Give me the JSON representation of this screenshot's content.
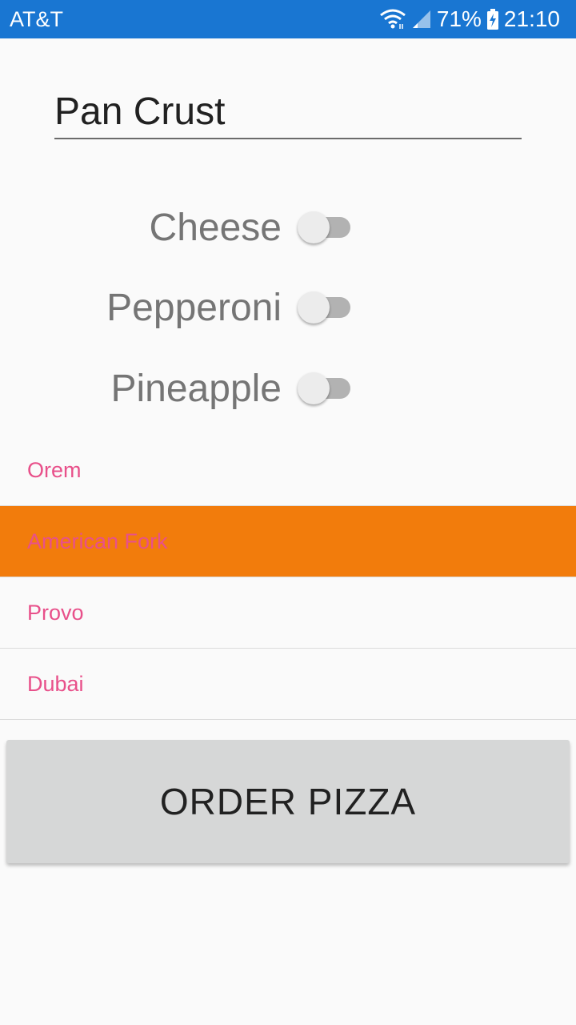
{
  "status_bar": {
    "carrier": "AT&T",
    "battery": "71%",
    "time": "21:10",
    "icons": [
      "wifi-icon",
      "signal-icon",
      "battery-charging-icon"
    ],
    "background": "#1976d2"
  },
  "crust": {
    "value": "Pan Crust"
  },
  "toppings": [
    {
      "label": "Cheese",
      "on": false
    },
    {
      "label": "Pepperoni",
      "on": false
    },
    {
      "label": "Pineapple",
      "on": false
    }
  ],
  "locations": {
    "items": [
      "Orem",
      "American Fork",
      "Provo",
      "Dubai"
    ],
    "selected": "American Fork",
    "text_color": "#e8508a",
    "selected_background": "#f27c0c"
  },
  "order_button": {
    "label": "ORDER PIZZA"
  }
}
